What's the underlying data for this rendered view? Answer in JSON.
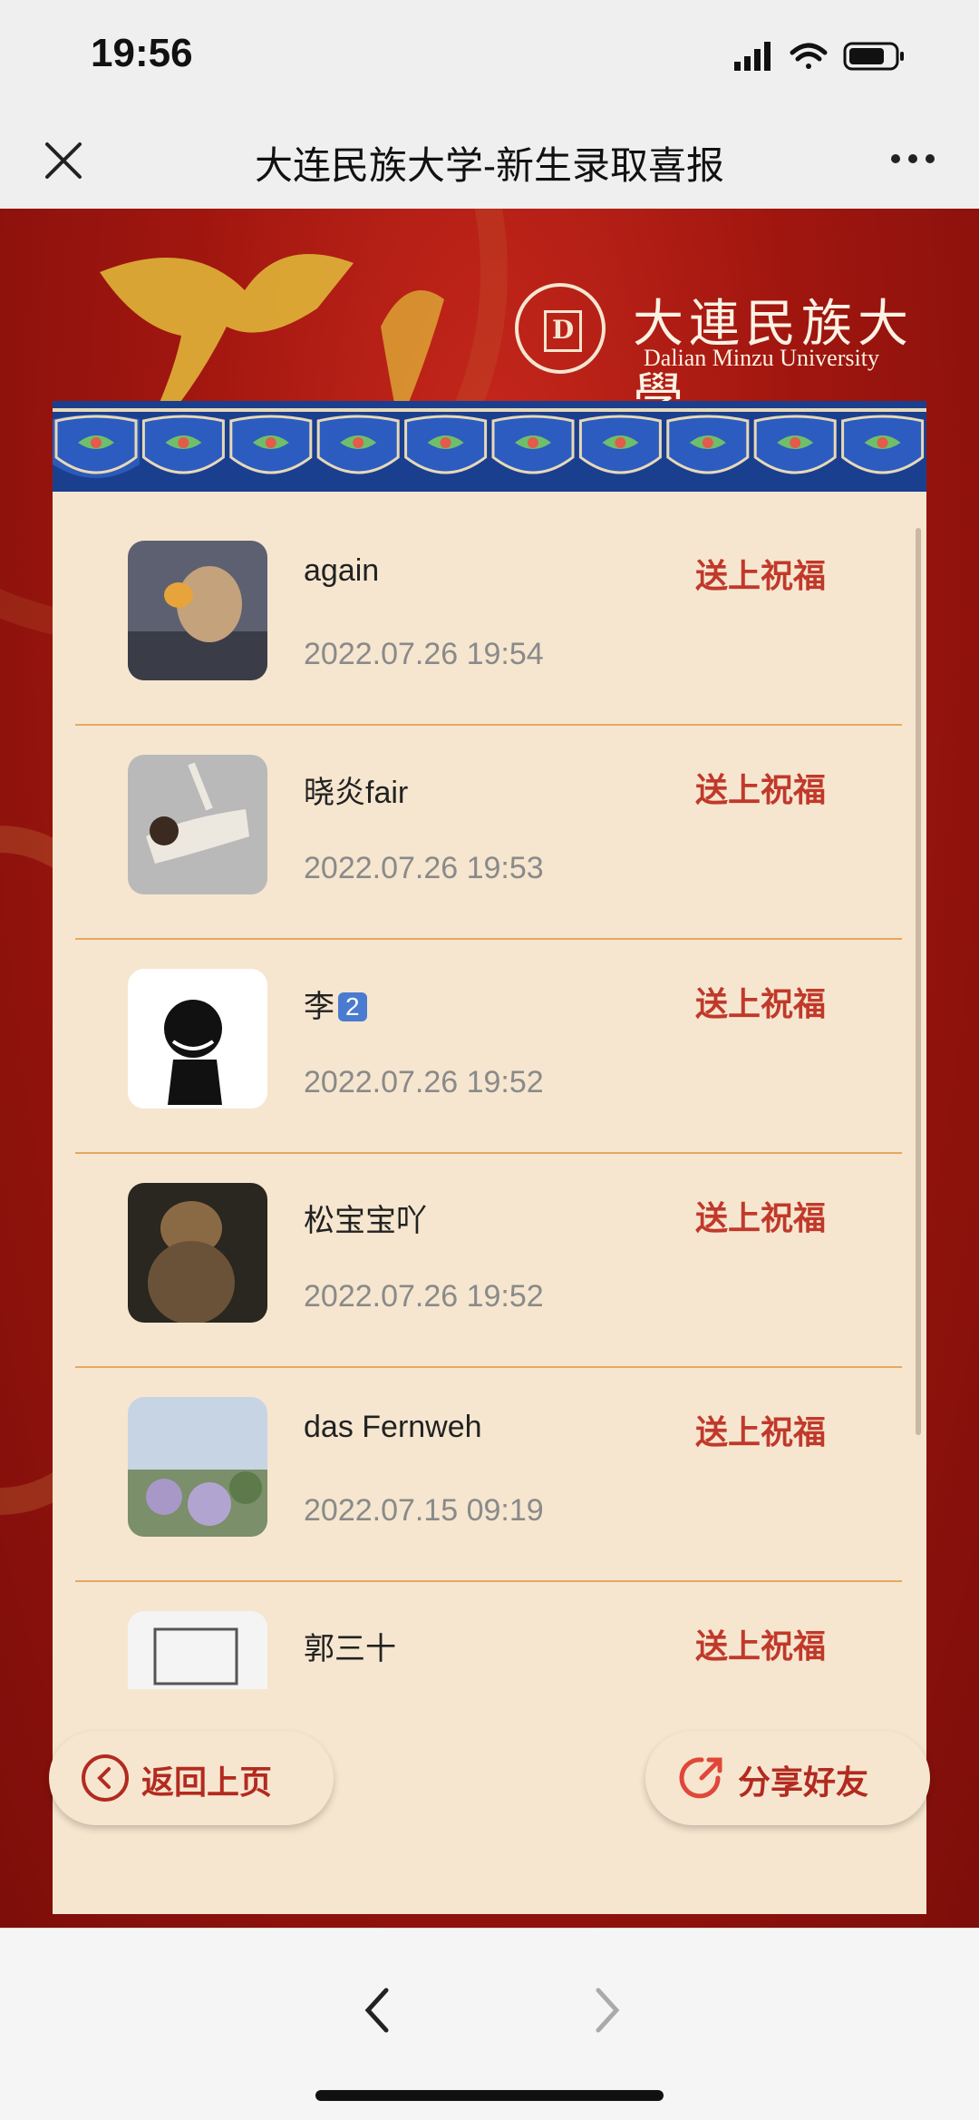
{
  "status_bar": {
    "time": "19:56"
  },
  "nav": {
    "title": "大连民族大学-新生录取喜报"
  },
  "logo": {
    "cn": "大連民族大學",
    "en": "Dalian Minzu University",
    "seal": "D"
  },
  "list": {
    "bless_label": "送上祝福",
    "items": [
      {
        "name": "again",
        "time": "2022.07.26 19:54"
      },
      {
        "name": "晓炎fair",
        "time": "2022.07.26 19:53"
      },
      {
        "name": "李",
        "badge": "2",
        "time": "2022.07.26 19:52"
      },
      {
        "name": "松宝宝吖",
        "time": "2022.07.26 19:52"
      },
      {
        "name": "das Fernweh",
        "time": "2022.07.15 09:19"
      },
      {
        "name": "郭三十",
        "time": ""
      }
    ]
  },
  "buttons": {
    "back": "返回上页",
    "share": "分享好友"
  },
  "colors": {
    "accent": "#c0392b",
    "panel": "#f6e6cf",
    "banner": "#a0160f",
    "border_blue": "#1b3f8f"
  }
}
